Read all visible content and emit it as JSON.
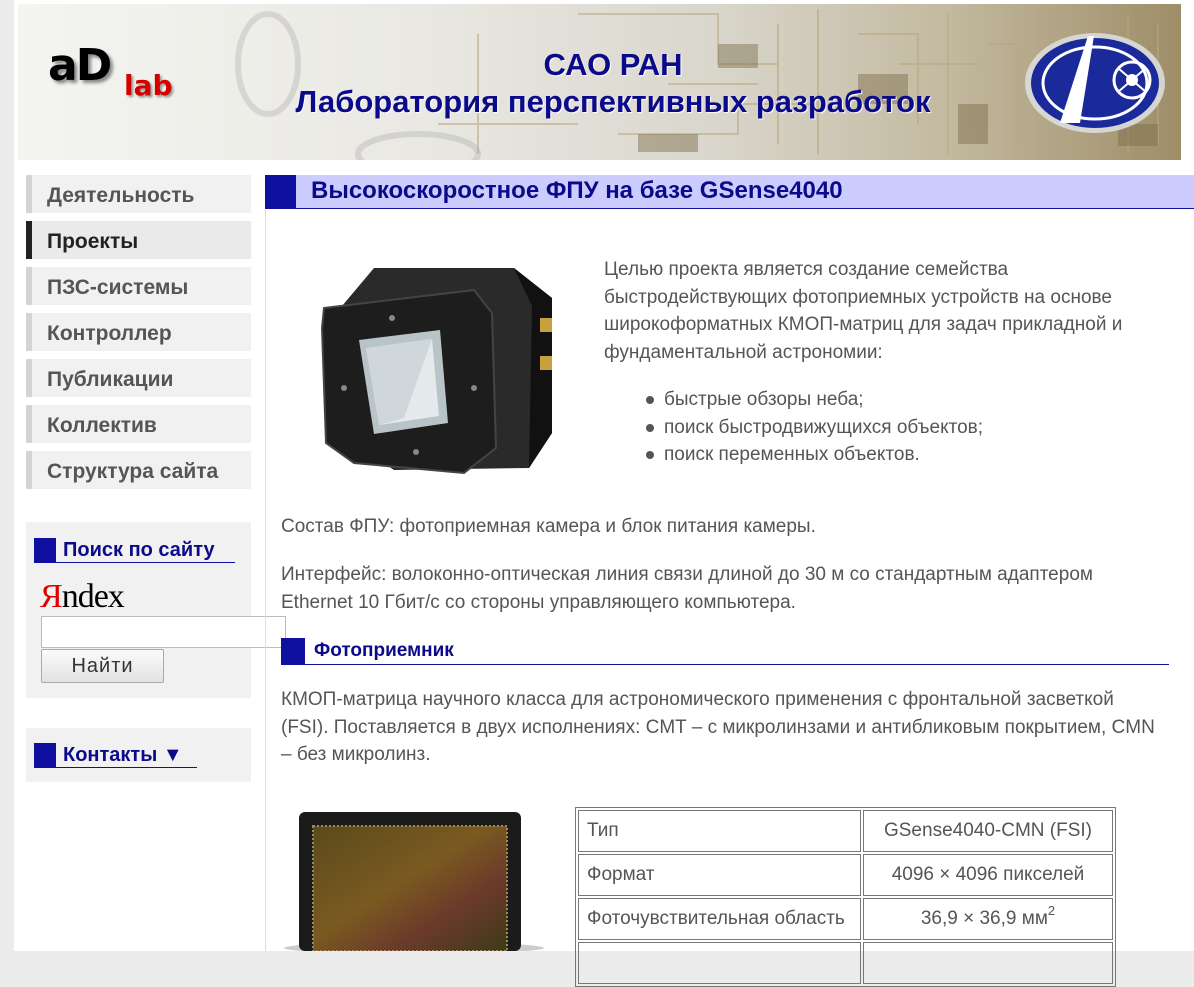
{
  "header": {
    "logo_main": "aD",
    "logo_sub": "lab",
    "title_line1": "САО РАН",
    "title_line2": "Лаборатория перспективных разработок"
  },
  "sidebar": {
    "menu": [
      {
        "label": "Деятельность",
        "active": false
      },
      {
        "label": "Проекты",
        "active": true
      },
      {
        "label": "ПЗС-системы",
        "active": false
      },
      {
        "label": "Контроллер",
        "active": false
      },
      {
        "label": "Публикации",
        "active": false
      },
      {
        "label": "Коллектив",
        "active": false
      },
      {
        "label": "Структура сайта",
        "active": false
      }
    ],
    "search": {
      "title": "Поиск по сайту",
      "yandex_y": "Я",
      "yandex_rest": "ndex",
      "input_value": "",
      "button_label": "Найти"
    },
    "contacts": {
      "title": "Контакты ▼"
    }
  },
  "main": {
    "title": "Высокоскоростное ФПУ на базе GSense4040",
    "intro": "Целью проекта является создание семейства быстродействующих фотоприемных устройств на основе широкоформатных КМОП-матриц для задач прикладной и фундаментальной астрономии:",
    "bullets": [
      "быстрые обзоры неба;",
      "поиск быстродвижущихся объектов;",
      "поиск переменных объектов."
    ],
    "composition": "Состав ФПУ: фотоприемная камера и блок питания камеры.",
    "interface": "Интерфейс: волоконно-оптическая линия связи длиной до 30 м со стандартным адаптером Ethernet 10 Гбит/с со стороны управляющего компьютера.",
    "section_title": "Фотоприемник",
    "sensor_text": "КМОП-матрица научного класса для астрономического применения с фронтальной засветкой (FSI). Поставляется в двух исполнениях: CMT – с микролинзами и антибликовым покрытием, CMN – без микролинз.",
    "spec_table": [
      {
        "label": "Тип",
        "value": "GSense4040-CMN (FSI)"
      },
      {
        "label": "Формат",
        "value": "4096 × 4096 пикселей"
      },
      {
        "label": "Фоточувствительная область",
        "value": "36,9 × 36,9 мм",
        "sup": "2"
      }
    ]
  },
  "colors": {
    "accent": "#1010a0",
    "title_bg": "#ccccff",
    "heading_text": "#0a0a8a",
    "logo_red": "#d40000"
  }
}
